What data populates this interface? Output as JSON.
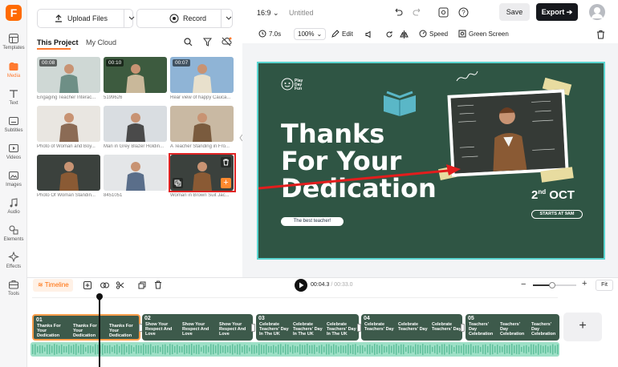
{
  "app": {
    "logo_letter": "F",
    "brand_color": "#ff6a00"
  },
  "rail": [
    {
      "label": "Templates",
      "icon": "templates-icon"
    },
    {
      "label": "Media",
      "icon": "media-icon",
      "active": true
    },
    {
      "label": "Text",
      "icon": "text-icon"
    },
    {
      "label": "Subtitles",
      "icon": "subtitles-icon"
    },
    {
      "label": "Videos",
      "icon": "videos-icon"
    },
    {
      "label": "Images",
      "icon": "images-icon"
    },
    {
      "label": "Audio",
      "icon": "audio-icon"
    },
    {
      "label": "Elements",
      "icon": "elements-icon"
    },
    {
      "label": "Effects",
      "icon": "effects-icon"
    },
    {
      "label": "Tools",
      "icon": "tools-icon"
    }
  ],
  "panel": {
    "upload_label": "Upload Files",
    "record_label": "Record",
    "tab_project": "This Project",
    "tab_cloud": "My Cloud",
    "media": [
      {
        "caption": "Engaging Teacher Interac...",
        "duration": "00:08"
      },
      {
        "caption": "5199626",
        "duration": "00:10"
      },
      {
        "caption": "Rear view of happy Cauca...",
        "duration": "00:07"
      },
      {
        "caption": "Photo of Woman and Boy..."
      },
      {
        "caption": "Man in Grey Blazer Holdin..."
      },
      {
        "caption": "A Teacher Standing in Fro..."
      },
      {
        "caption": "Photo Of Woman Standin..."
      },
      {
        "caption": "8451051"
      },
      {
        "caption": "Woman in Brown Suit Jac..."
      }
    ]
  },
  "topbar": {
    "aspect": "16:9",
    "title": "Untitled",
    "save_label": "Save",
    "export_label": "Export"
  },
  "toolbar": {
    "duration": "7.0s",
    "zoom": "100%",
    "edit": "Edit",
    "speed": "Speed",
    "green_screen": "Green Screen"
  },
  "slide": {
    "brand": "Play Day Fun",
    "line1": "Thanks",
    "line2": "For Your",
    "line3": "Dedication",
    "date_num": "2",
    "date_sup": "nd",
    "date_month": "OCT",
    "starts": "STARTS AT 9AM",
    "pill": "The best teacher!",
    "bg_color": "#2f5544"
  },
  "timeline": {
    "label": "Timeline",
    "current_time": "00:04.3",
    "total_time": "00:33.0",
    "fit_label": "Fit",
    "add_label": "+",
    "zoom_level": 0.45,
    "clips": [
      {
        "num": "01",
        "text": "Thanks For Your Dedication"
      },
      {
        "num": "02",
        "text": "Show Your Respect And Love"
      },
      {
        "num": "03",
        "text": "Celebrate Teachers' Day In The UK"
      },
      {
        "num": "04",
        "text": "Celebrate Teachers' Day"
      },
      {
        "num": "05",
        "text": "Teachers' Day Celebration"
      }
    ]
  }
}
